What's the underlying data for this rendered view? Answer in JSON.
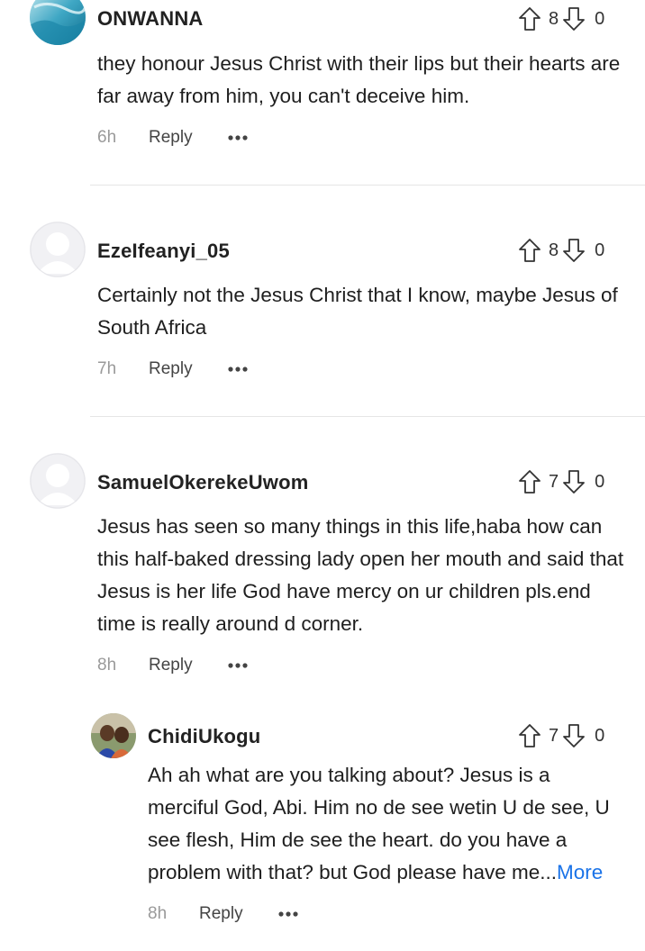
{
  "comments": [
    {
      "username": "ONWANNA",
      "upvotes": "8",
      "downvotes": "0",
      "text": "they honour Jesus Christ with their lips but their hearts are far away from him, you can't deceive him.",
      "time": "6h",
      "reply_label": "Reply",
      "avatar": "photo-avatar-blue"
    },
    {
      "username": "EzeIfeanyi_05",
      "upvotes": "8",
      "downvotes": "0",
      "text": "Certainly not the Jesus Christ that I know, maybe Jesus of South Africa",
      "time": "7h",
      "reply_label": "Reply",
      "avatar": "default-user-avatar"
    },
    {
      "username": "SamuelOkerekeUwom",
      "upvotes": "7",
      "downvotes": "0",
      "text": "Jesus has seen so many things in this life,haba how can this half-baked dressing lady open her mouth  and said that Jesus is her life God have mercy on ur children pls.end time is really around d corner.",
      "time": "8h",
      "reply_label": "Reply",
      "avatar": "default-user-avatar"
    }
  ],
  "reply": {
    "username": "ChidiUkogu",
    "upvotes": "7",
    "downvotes": "0",
    "text": "Ah ah what are you talking about? Jesus is a merciful God, Abi. Him no de see wetin U de see, U see flesh, Him de see the heart. do you have a problem with that? but God please have me...",
    "more_label": "More",
    "time": "8h",
    "reply_label": "Reply",
    "avatar": "photo-avatar-people"
  },
  "icons": {
    "upvote": "arrow-up-outline-icon",
    "downvote": "arrow-down-outline-icon",
    "options": "more-dots-icon"
  },
  "colors": {
    "link": "#1a73e8",
    "timestamp": "#9a9a9a",
    "divider": "#e6e6e6"
  }
}
